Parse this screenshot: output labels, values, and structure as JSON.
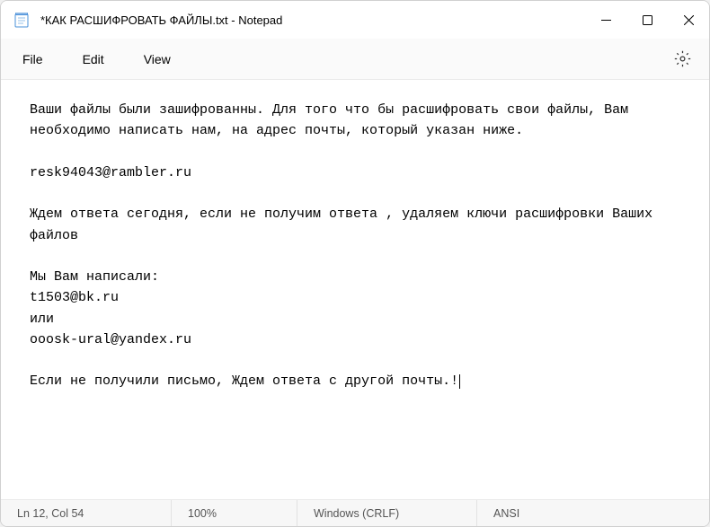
{
  "titlebar": {
    "title": "*КАК РАСШИФРОВАТЬ ФАЙЛЫ.txt - Notepad"
  },
  "menubar": {
    "file": "File",
    "edit": "Edit",
    "view": "View"
  },
  "content": {
    "text": "Ваши файлы были зашифрованны. Для того что бы расшифровать свои файлы, Вам необходимо написать нам, на адрес почты, который указан ниже.\n\nresk94043@rambler.ru\n\nЖдем ответа сегодня, если не получим ответа , удаляем ключи расшифровки Ваших файлов\n\nМы Вам написали:\nt1503@bk.ru\nили\nooosk-ural@yandex.ru\n\nЕсли не получили письмо, Ждем ответа с другой почты.!"
  },
  "statusbar": {
    "position": "Ln 12, Col 54",
    "zoom": "100%",
    "eol": "Windows (CRLF)",
    "encoding": "ANSI"
  }
}
